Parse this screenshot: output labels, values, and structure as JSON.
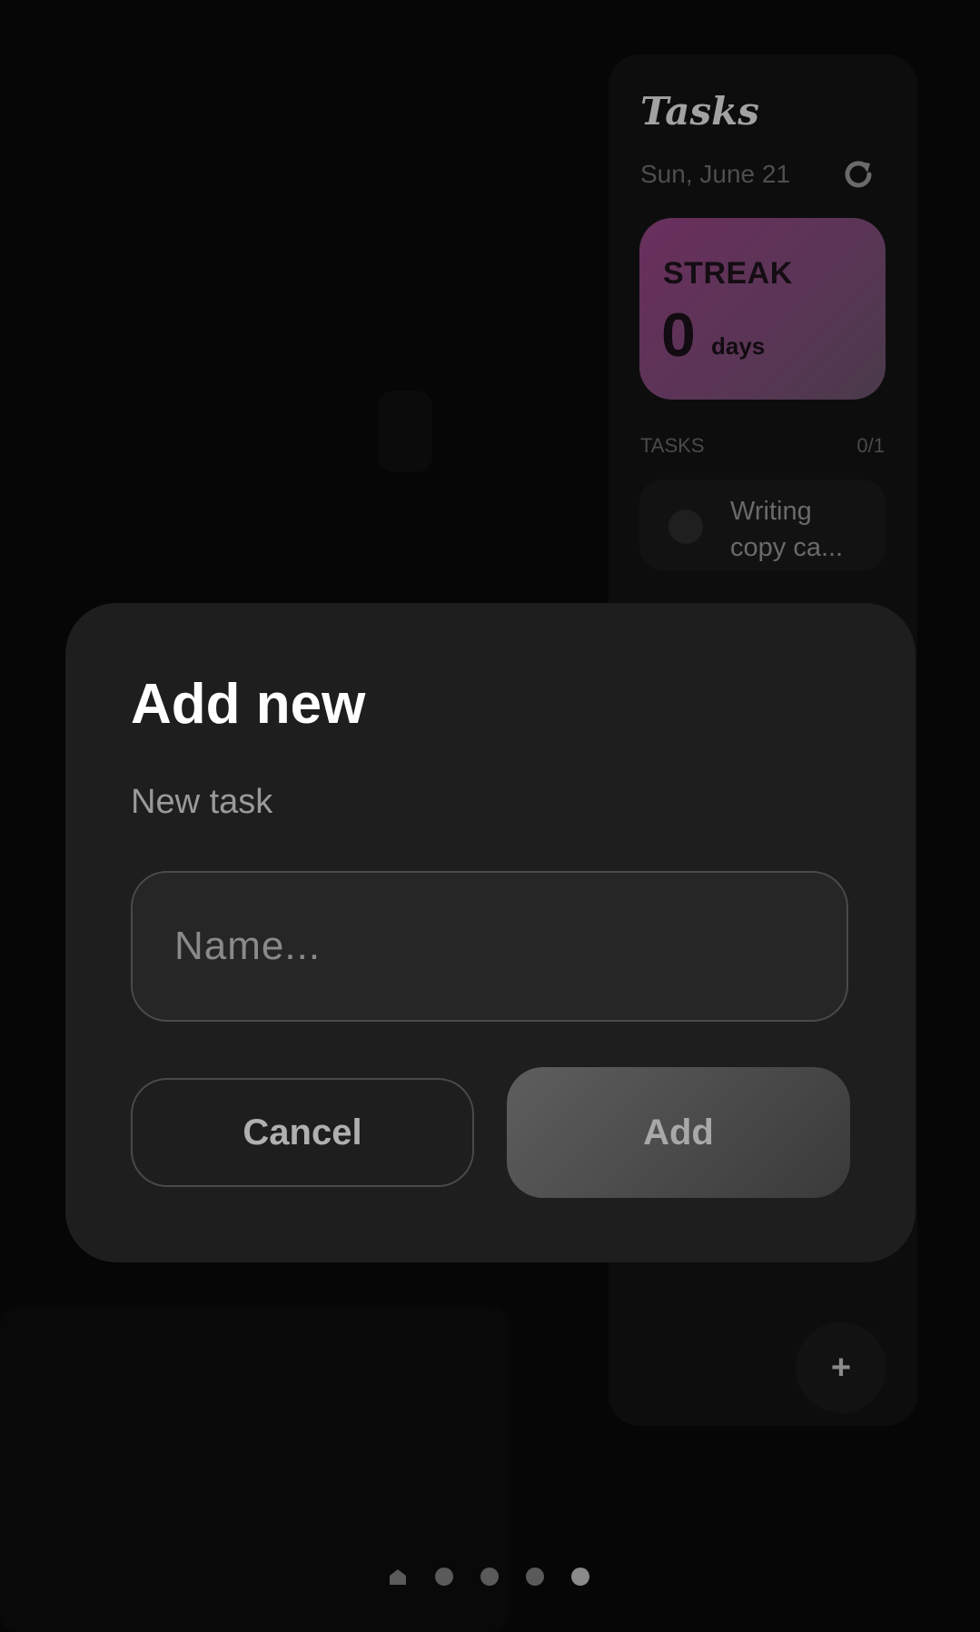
{
  "widget": {
    "title": "Tasks",
    "date": "Sun, June 21",
    "icons": {
      "refresh": "refresh-icon",
      "add": "plus-icon"
    },
    "streak": {
      "label": "STREAK",
      "value": "0",
      "unit": "days",
      "colors": [
        "#6a2f5d",
        "#4a3a4a"
      ]
    },
    "tasks_header": "TASKS",
    "tasks_count": "0/1",
    "tasks": [
      {
        "text": "Writing copy ca...",
        "done": false
      }
    ],
    "fab_label": "+"
  },
  "dialog": {
    "title": "Add new",
    "subtitle": "New task",
    "name_input": {
      "value": "",
      "placeholder": "Name..."
    },
    "cancel_label": "Cancel",
    "add_label": "Add"
  },
  "page_indicator": {
    "pages": 5,
    "active_index": 4,
    "first_icon": "home-icon"
  }
}
